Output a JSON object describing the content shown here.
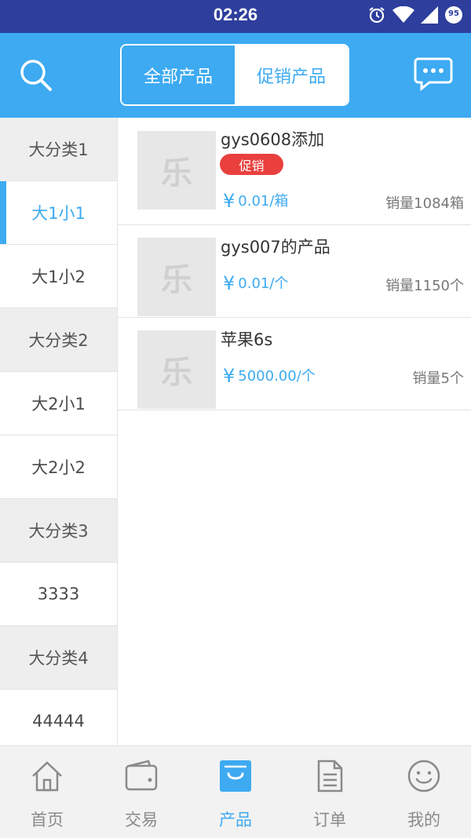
{
  "status_bar": {
    "time": "02:26",
    "battery": "95"
  },
  "header": {
    "tabs": [
      {
        "label": "全部产品",
        "active": true
      },
      {
        "label": "促销产品",
        "active": false
      }
    ],
    "accent_color": "#3daaf1"
  },
  "sidebar": {
    "items": [
      {
        "label": "大分类1",
        "type": "major"
      },
      {
        "label": "大1小1",
        "type": "minor",
        "selected": true
      },
      {
        "label": "大1小2",
        "type": "minor"
      },
      {
        "label": "大分类2",
        "type": "major"
      },
      {
        "label": "大2小1",
        "type": "minor"
      },
      {
        "label": "大2小2",
        "type": "minor"
      },
      {
        "label": "大分类3",
        "type": "major"
      },
      {
        "label": "3333",
        "type": "minor"
      },
      {
        "label": "大分类4",
        "type": "major"
      },
      {
        "label": "44444",
        "type": "minor"
      }
    ]
  },
  "products": [
    {
      "name": "gys0608添加",
      "promo_label": "促销",
      "price": "0.01/箱",
      "sales": "销量1084箱",
      "thumb": "乐"
    },
    {
      "name": "gys007的产品",
      "price": "0.01/个",
      "sales": "销量1150个",
      "thumb": "乐"
    },
    {
      "name": "苹果6s",
      "price": "5000.00/个",
      "sales": "销量5个",
      "thumb": "乐"
    }
  ],
  "currency_symbol": "¥",
  "bottom_nav": {
    "items": [
      {
        "label": "首页",
        "icon": "home-icon"
      },
      {
        "label": "交易",
        "icon": "wallet-icon"
      },
      {
        "label": "产品",
        "icon": "bag-icon",
        "active": true
      },
      {
        "label": "订单",
        "icon": "document-icon"
      },
      {
        "label": "我的",
        "icon": "smiley-icon"
      }
    ]
  }
}
